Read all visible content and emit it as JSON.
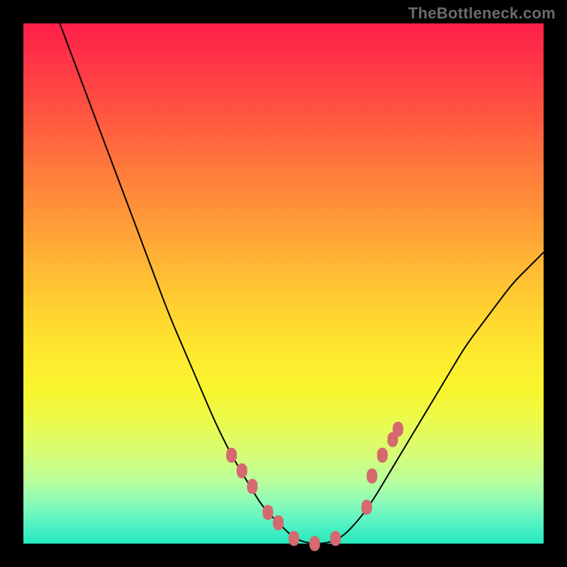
{
  "watermark": "TheBottleneck.com",
  "colors": {
    "page_bg": "#000000",
    "watermark": "#6b6b6b",
    "curve": "#000000",
    "marker": "#d66870",
    "gradient_stops": [
      "#ff1f4a",
      "#ff3a45",
      "#ff5740",
      "#ff7a3c",
      "#ff9a38",
      "#ffb934",
      "#ffd530",
      "#feea2f",
      "#f7f62f",
      "#e9fb50",
      "#d5fd78",
      "#b9fe9c",
      "#8cfbb8",
      "#56f3c3",
      "#22e8be"
    ]
  },
  "chart_data": {
    "type": "line",
    "title": "",
    "xlabel": "",
    "ylabel": "",
    "xlim": [
      0,
      100
    ],
    "ylim": [
      0,
      100
    ],
    "grid": false,
    "legend": false,
    "x": [
      7,
      10,
      13,
      16,
      19,
      22,
      25,
      28,
      31,
      34,
      37,
      40,
      43,
      46,
      49,
      52,
      55,
      58,
      61,
      64,
      67,
      70,
      73,
      76,
      79,
      82,
      85,
      88,
      91,
      94,
      97,
      100
    ],
    "values": [
      100,
      92,
      84,
      76,
      68,
      60,
      52,
      44,
      37,
      30,
      23,
      17,
      12,
      7,
      4,
      1,
      0,
      0,
      1,
      4,
      8,
      13,
      18,
      23,
      28,
      33,
      38,
      42,
      46,
      50,
      53,
      56
    ],
    "series": [
      {
        "name": "markers",
        "marker_only": true,
        "x": [
          40,
          42,
          44,
          47,
          49,
          52,
          56,
          60,
          66,
          67,
          69,
          71,
          72
        ],
        "values": [
          17,
          14,
          11,
          6,
          4,
          1,
          0,
          1,
          7,
          13,
          17,
          20,
          22
        ]
      }
    ]
  }
}
